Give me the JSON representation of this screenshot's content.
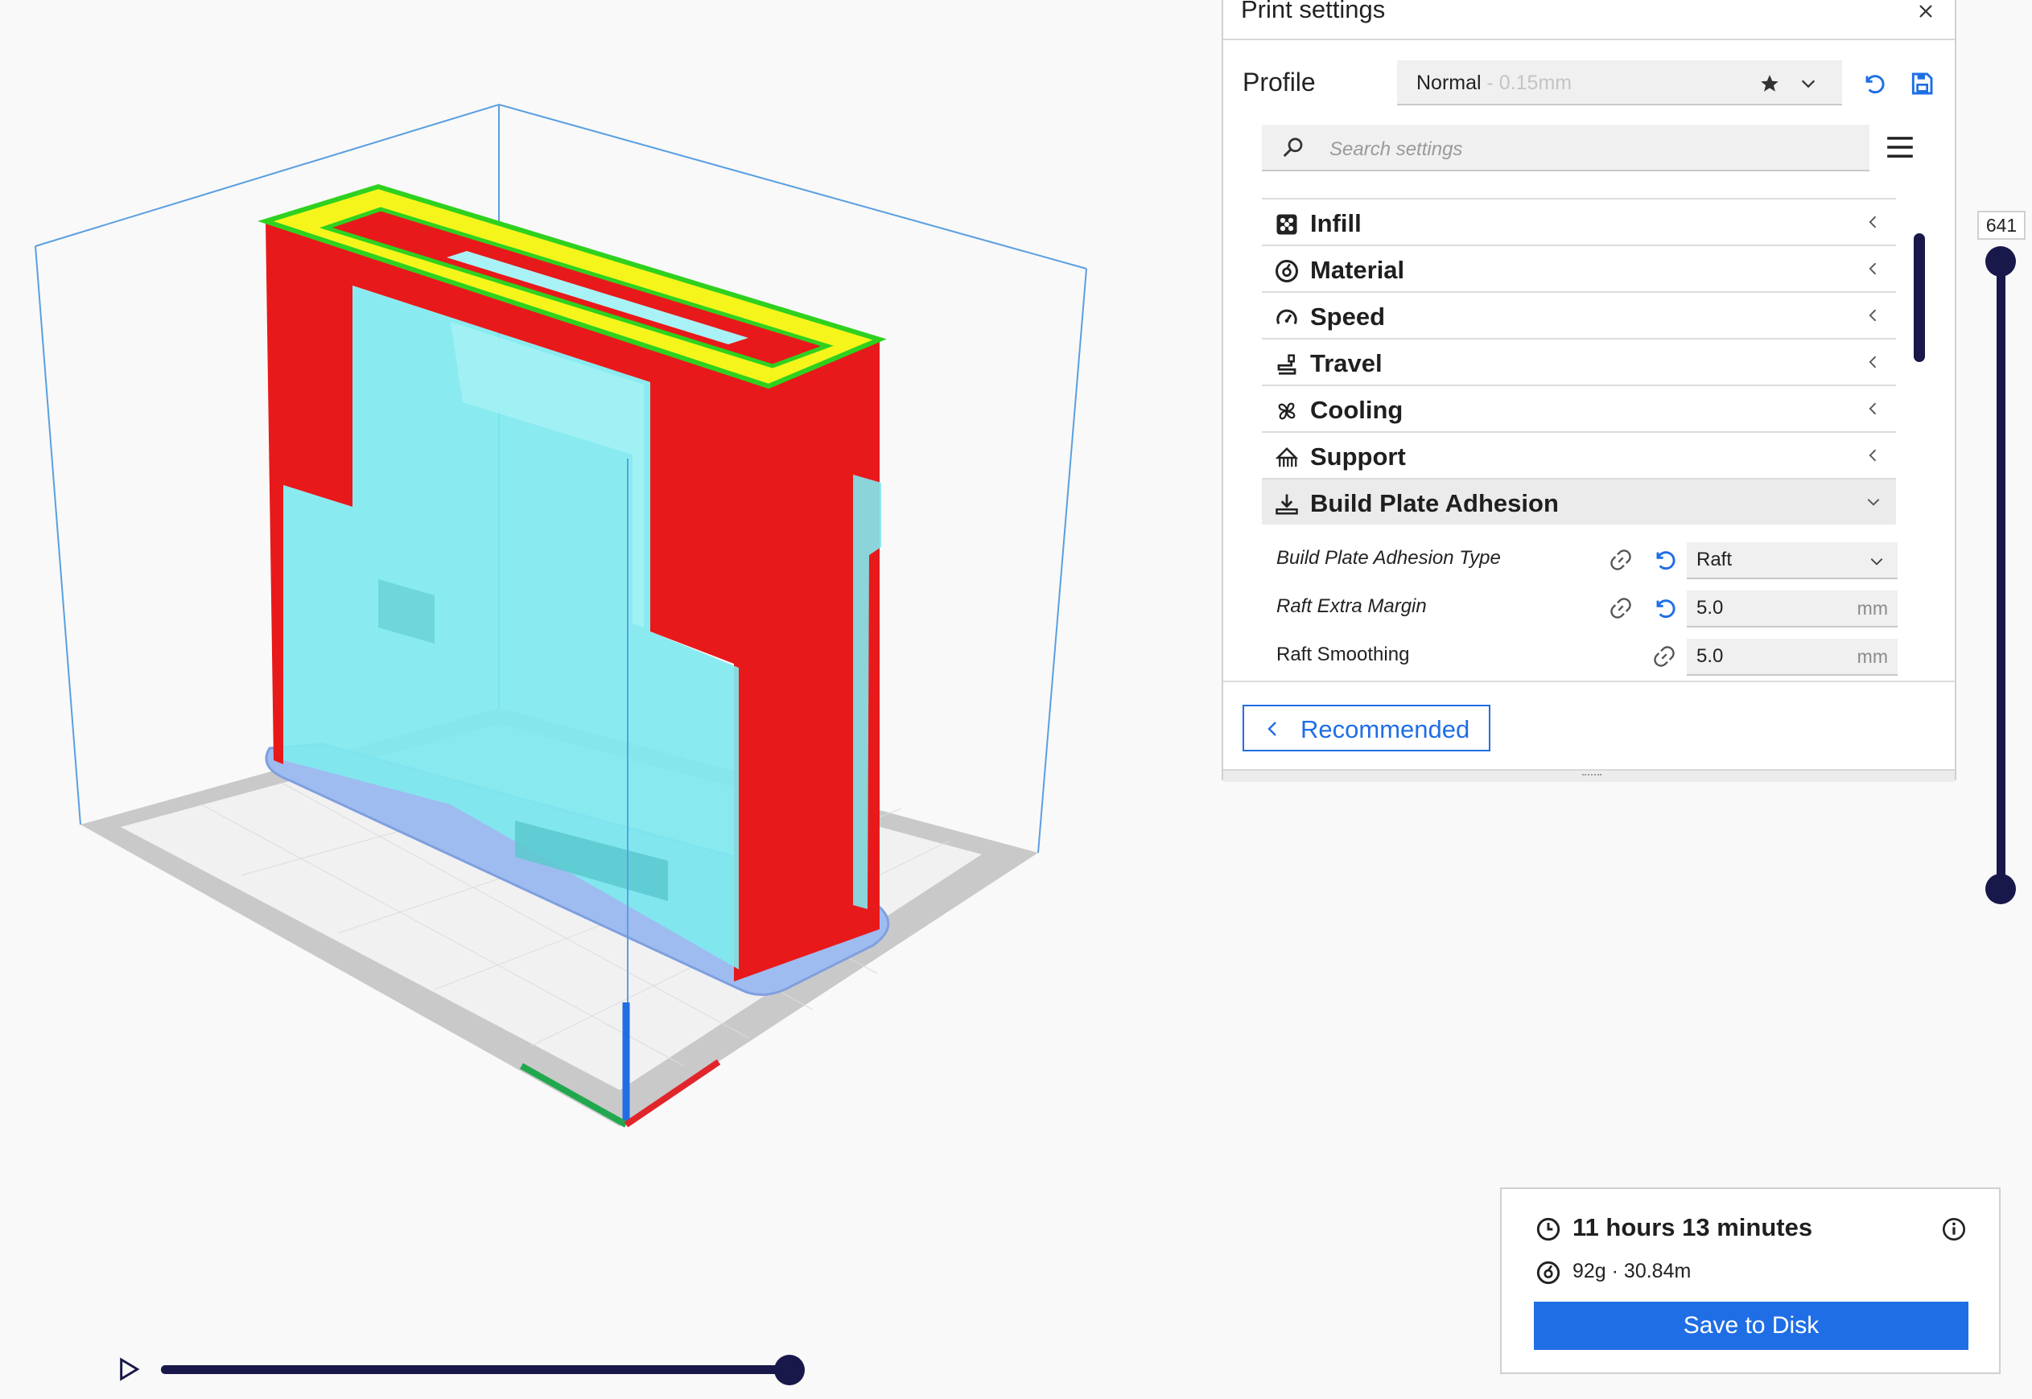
{
  "panel": {
    "title": "Print settings",
    "close_icon": "close-icon",
    "profile": {
      "label": "Profile",
      "name": "Normal",
      "layer_height": " - 0.15mm",
      "star_icon": "star-icon",
      "chevron_icon": "chevron-down-icon",
      "reset_icon": "undo-icon",
      "save_icon": "save-icon"
    },
    "search": {
      "placeholder": "Search settings",
      "icon": "search-icon"
    },
    "menu_icon": "hamburger-menu-icon",
    "categories": [
      {
        "label": "Infill",
        "icon": "infill-icon",
        "expanded": false
      },
      {
        "label": "Material",
        "icon": "material-icon",
        "expanded": false
      },
      {
        "label": "Speed",
        "icon": "speed-icon",
        "expanded": false
      },
      {
        "label": "Travel",
        "icon": "travel-icon",
        "expanded": false
      },
      {
        "label": "Cooling",
        "icon": "cooling-fan-icon",
        "expanded": false
      },
      {
        "label": "Support",
        "icon": "support-icon",
        "expanded": false
      },
      {
        "label": "Build Plate Adhesion",
        "icon": "build-plate-adhesion-icon",
        "expanded": true
      }
    ],
    "settings": [
      {
        "label": "Build Plate Adhesion Type",
        "value": "Raft",
        "unit": ""
      },
      {
        "label": "Raft Extra Margin",
        "value": "5.0",
        "unit": "mm"
      },
      {
        "label": "Raft Smoothing",
        "value": "5.0",
        "unit": "mm"
      }
    ],
    "recommended_label": "Recommended"
  },
  "layer_slider": {
    "value": "641",
    "upper_level": 1.0,
    "lower_level": 0.0
  },
  "playback": {
    "progress": 1.0
  },
  "estimate": {
    "time": "11 hours 13 minutes",
    "material": "92g · 30.84m",
    "save_label": "Save to Disk"
  },
  "colors": {
    "accent": "#1f6ee5",
    "slider": "#18184a",
    "wall_outer": "#e8191a",
    "wall_inner": "#2fd11f",
    "top_skin": "#f5f51c",
    "support": "#7fe9ef",
    "raft": "#9fbcf0",
    "build_volume": "#4a90d9"
  }
}
